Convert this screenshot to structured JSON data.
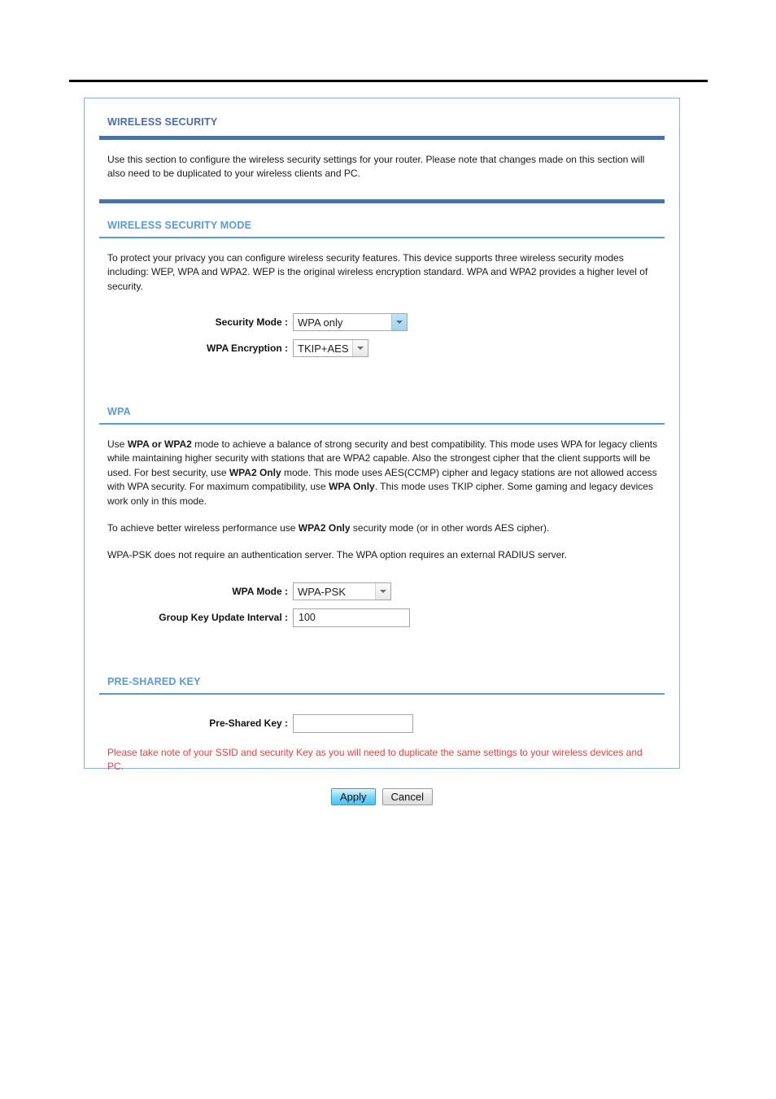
{
  "page": {
    "panel_title": "WIRELESS SECURITY",
    "intro": "Use this section to configure the wireless security settings for your router. Please note that changes made on this section will also need to be duplicated to your wireless clients and PC."
  },
  "security_mode_section": {
    "heading": "WIRELESS SECURITY MODE",
    "description": "To protect your privacy you can configure wireless security features. This device supports three wireless security modes including: WEP, WPA and WPA2. WEP is the original wireless encryption standard. WPA and WPA2 provides a higher level of security.",
    "fields": {
      "security_mode_label": "Security Mode :",
      "security_mode_value": "WPA only",
      "wpa_encryption_label": "WPA Encryption :",
      "wpa_encryption_value": "TKIP+AES"
    }
  },
  "wpa_section": {
    "heading": "WPA",
    "paragraph1_parts": {
      "t1": "Use ",
      "b1": "WPA or WPA2",
      "t2": " mode to achieve a balance of strong security and best compatibility. This mode uses WPA for legacy clients while maintaining higher security with stations that are WPA2 capable. Also the strongest cipher that the client supports will be used. For best security, use ",
      "b2": "WPA2 Only",
      "t3": " mode. This mode uses AES(CCMP) cipher and legacy stations are not allowed access with WPA security. For maximum compatibility, use ",
      "b3": "WPA Only",
      "t4": ". This mode uses TKIP cipher. Some gaming and legacy devices work only in this mode."
    },
    "paragraph2_parts": {
      "t1": "To achieve better wireless performance use ",
      "b1": "WPA2 Only",
      "t2": " security mode (or in other words AES cipher)."
    },
    "paragraph3": "WPA-PSK does not require an authentication server. The WPA option requires an external RADIUS server.",
    "fields": {
      "wpa_mode_label": "WPA Mode :",
      "wpa_mode_value": "WPA-PSK",
      "group_key_label": "Group Key Update Interval :",
      "group_key_value": "100"
    }
  },
  "preshared_section": {
    "heading": "PRE-SHARED KEY",
    "fields": {
      "psk_label": "Pre-Shared Key :",
      "psk_value": "",
      "psk_placeholder": ""
    },
    "warning": "Please take note of your SSID and security Key as you will need to duplicate the same settings to your wireless devices and PC."
  },
  "buttons": {
    "apply": "Apply",
    "cancel": "Cancel"
  },
  "colors": {
    "heading_main": "#4b6cb0",
    "heading_sub": "#5b9bd5",
    "rule_thick": "#4472b8",
    "rule_thin": "#5b9bd5",
    "panel_border": "#88aedd",
    "warning_text": "#fb3b3b",
    "apply_button": "#4cc3f2"
  }
}
